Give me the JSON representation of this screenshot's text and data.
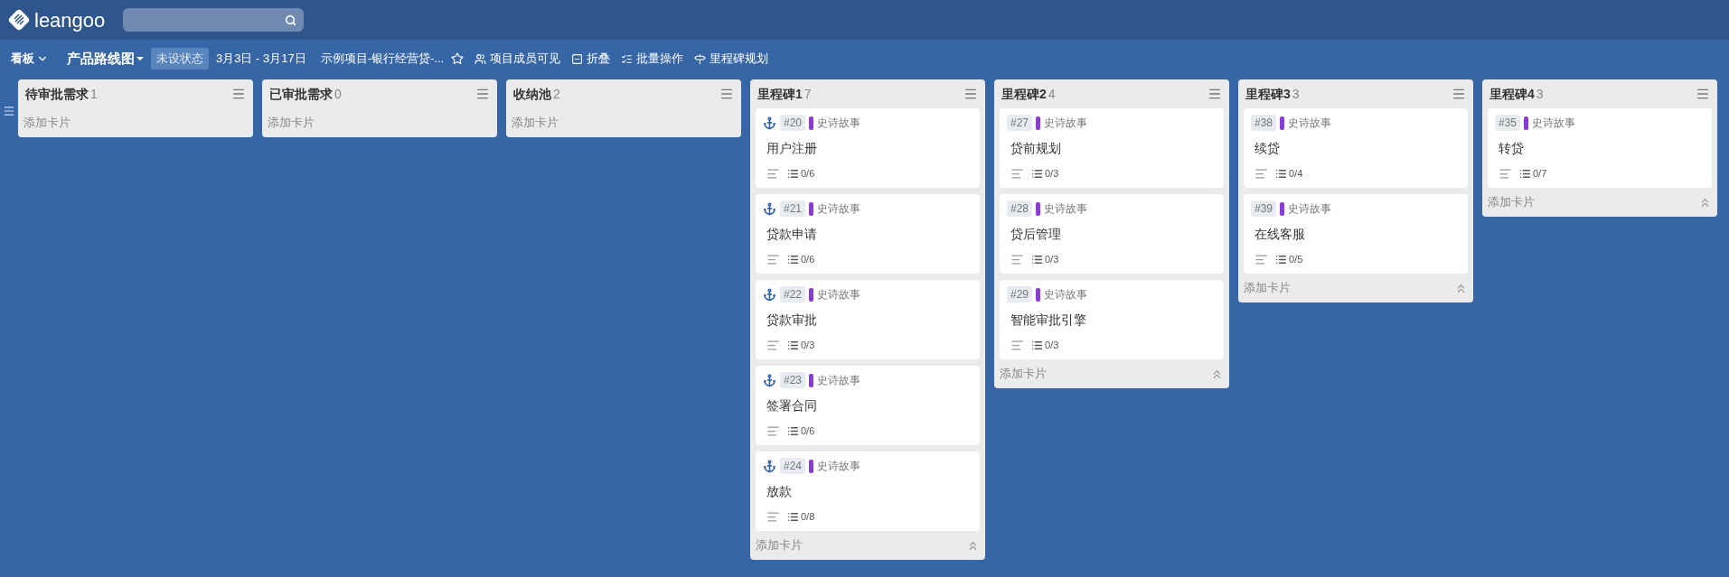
{
  "header": {
    "logo": "leangoo"
  },
  "toolbar": {
    "view": "看板",
    "board": "产品路线图",
    "status": "未设状态",
    "dates": "3月3日 - 3月17日",
    "project": "示例项目-银行经营贷-...",
    "starred": false,
    "items": [
      {
        "kind": "members",
        "label": "项目成员可见"
      },
      {
        "kind": "collapse",
        "label": "折叠"
      },
      {
        "kind": "batch",
        "label": "批量操作"
      },
      {
        "kind": "milestone",
        "label": "里程碑规划"
      }
    ]
  },
  "columns": [
    {
      "title": "待审批需求",
      "count": "1",
      "add": "添加卡片"
    },
    {
      "title": "已审批需求",
      "count": "0",
      "add": "添加卡片"
    },
    {
      "title": "收纳池",
      "count": "2",
      "add": "添加卡片"
    },
    {
      "title": "里程碑1",
      "count": "7",
      "add": "添加卡片",
      "cards": [
        {
          "anchored": true,
          "id": "#20",
          "tag": "史诗故事",
          "color": "#8a3ad6",
          "title": "用户注册",
          "checklist": "0/6"
        },
        {
          "anchored": true,
          "id": "#21",
          "tag": "史诗故事",
          "color": "#8a3ad6",
          "title": "贷款申请",
          "checklist": "0/6"
        },
        {
          "anchored": true,
          "id": "#22",
          "tag": "史诗故事",
          "color": "#8a3ad6",
          "title": "贷款审批",
          "checklist": "0/3"
        },
        {
          "anchored": true,
          "id": "#23",
          "tag": "史诗故事",
          "color": "#8a3ad6",
          "title": "签署合同",
          "checklist": "0/6"
        },
        {
          "anchored": true,
          "id": "#24",
          "tag": "史诗故事",
          "color": "#8a3ad6",
          "title": "放款",
          "checklist": "0/8"
        }
      ]
    },
    {
      "title": "里程碑2",
      "count": "4",
      "add": "添加卡片",
      "cards": [
        {
          "anchored": false,
          "id": "#27",
          "tag": "史诗故事",
          "color": "#8a3ad6",
          "title": "贷前规划",
          "checklist": "0/3"
        },
        {
          "anchored": false,
          "id": "#28",
          "tag": "史诗故事",
          "color": "#8a3ad6",
          "title": "贷后管理",
          "checklist": "0/3"
        },
        {
          "anchored": false,
          "id": "#29",
          "tag": "史诗故事",
          "color": "#8a3ad6",
          "title": "智能审批引擎",
          "checklist": "0/3"
        }
      ]
    },
    {
      "title": "里程碑3",
      "count": "3",
      "add": "添加卡片",
      "cards": [
        {
          "anchored": false,
          "id": "#38",
          "tag": "史诗故事",
          "color": "#8a3ad6",
          "title": "续贷",
          "checklist": "0/4"
        },
        {
          "anchored": false,
          "id": "#39",
          "tag": "史诗故事",
          "color": "#8a3ad6",
          "title": "在线客服",
          "checklist": "0/5"
        }
      ]
    },
    {
      "title": "里程碑4",
      "count": "3",
      "add": "添加卡片",
      "cards": [
        {
          "anchored": false,
          "id": "#35",
          "tag": "史诗故事",
          "color": "#8a3ad6",
          "title": "转贷",
          "checklist": "0/7"
        }
      ]
    }
  ]
}
